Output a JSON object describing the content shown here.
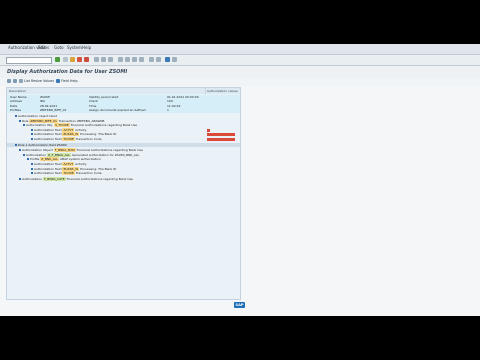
{
  "menubar": {
    "items": [
      "Authorization values",
      "Edit",
      "Goto",
      "System",
      "Help"
    ]
  },
  "window_controls": [
    "—",
    "□",
    "✕"
  ],
  "page_title": "Display Authorization Data for User ZSOMI",
  "app_toolbar": {
    "buttons": [
      "List Resize Values",
      "Field Help"
    ]
  },
  "column_headers": {
    "description": "Description",
    "authorization_values": "Authorization values"
  },
  "header_rows": [
    {
      "label": "User Name",
      "value": "ZSOMI",
      "label2": "Validity period start",
      "value2": "01.01.2021 00:00:00"
    },
    {
      "label": "Address",
      "value": "IBA",
      "label2": "Client",
      "value2": "100"
    },
    {
      "label": "Date",
      "value": "28.04.2021",
      "label2": "Time",
      "value2": "11:04:02"
    },
    {
      "label": "Profiles",
      "value": "ZBIFKBO_BIFE_01",
      "label2": "Assign documents expired an defined",
      "value2": "1"
    }
  ],
  "tree": [
    {
      "indent": 2,
      "text": "Authorization object Ident"
    },
    {
      "indent": 3,
      "text": "Role",
      "hl": "ZBIFKBO_BIFE_01",
      "rest": "Transaction ZBIFKBO_ABAWKB"
    },
    {
      "indent": 4,
      "text": "Authorization Obj.",
      "hl": "S_TCODE",
      "rest": "Financial Authorizations regarding Bank Use"
    },
    {
      "indent": 6,
      "text": "Authorization field",
      "hl": "ACTVT",
      "rest": "Activity"
    },
    {
      "indent": 6,
      "text": "Authorization field",
      "hl": "BUKRS_W",
      "rest": "Processing: The Bank ID"
    },
    {
      "indent": 6,
      "text": "Authorization field",
      "hl": "TCODE",
      "rest": "Transaction Code"
    },
    {
      "indent": 2,
      "text": "Role 1 Authorization field  ZSOMI",
      "sel": true
    },
    {
      "indent": 3,
      "text": "Authorization Object",
      "hl": "F_BNKA_MAN",
      "rest": "Financial Authorizations regarding Bank Use"
    },
    {
      "indent": 4,
      "text": "Authorization",
      "hlg": "Z_F_BNKA_ALL",
      "rest": "Generated authorization for ZSOMI_BNK_ALL"
    },
    {
      "indent": 5,
      "text": "Profile",
      "hl": "Z_BNK_ALL",
      "rest": "ABAP system authorization"
    },
    {
      "indent": 6,
      "text": "Authorization field",
      "hl": "ACTVT",
      "rest": "Activity"
    },
    {
      "indent": 6,
      "text": "Authorization field",
      "hl": "BUKRS_W",
      "rest": "Processing: The Bank ID"
    },
    {
      "indent": 6,
      "text": "Authorization field",
      "hl": "TCODE",
      "rest": "Transaction Code"
    },
    {
      "indent": 3,
      "text": "Authorization",
      "hlg": "F_BNKA_CATE",
      "rest": "Financial Authorizations regarding Bank Use"
    }
  ],
  "sap_logo": "SAP"
}
